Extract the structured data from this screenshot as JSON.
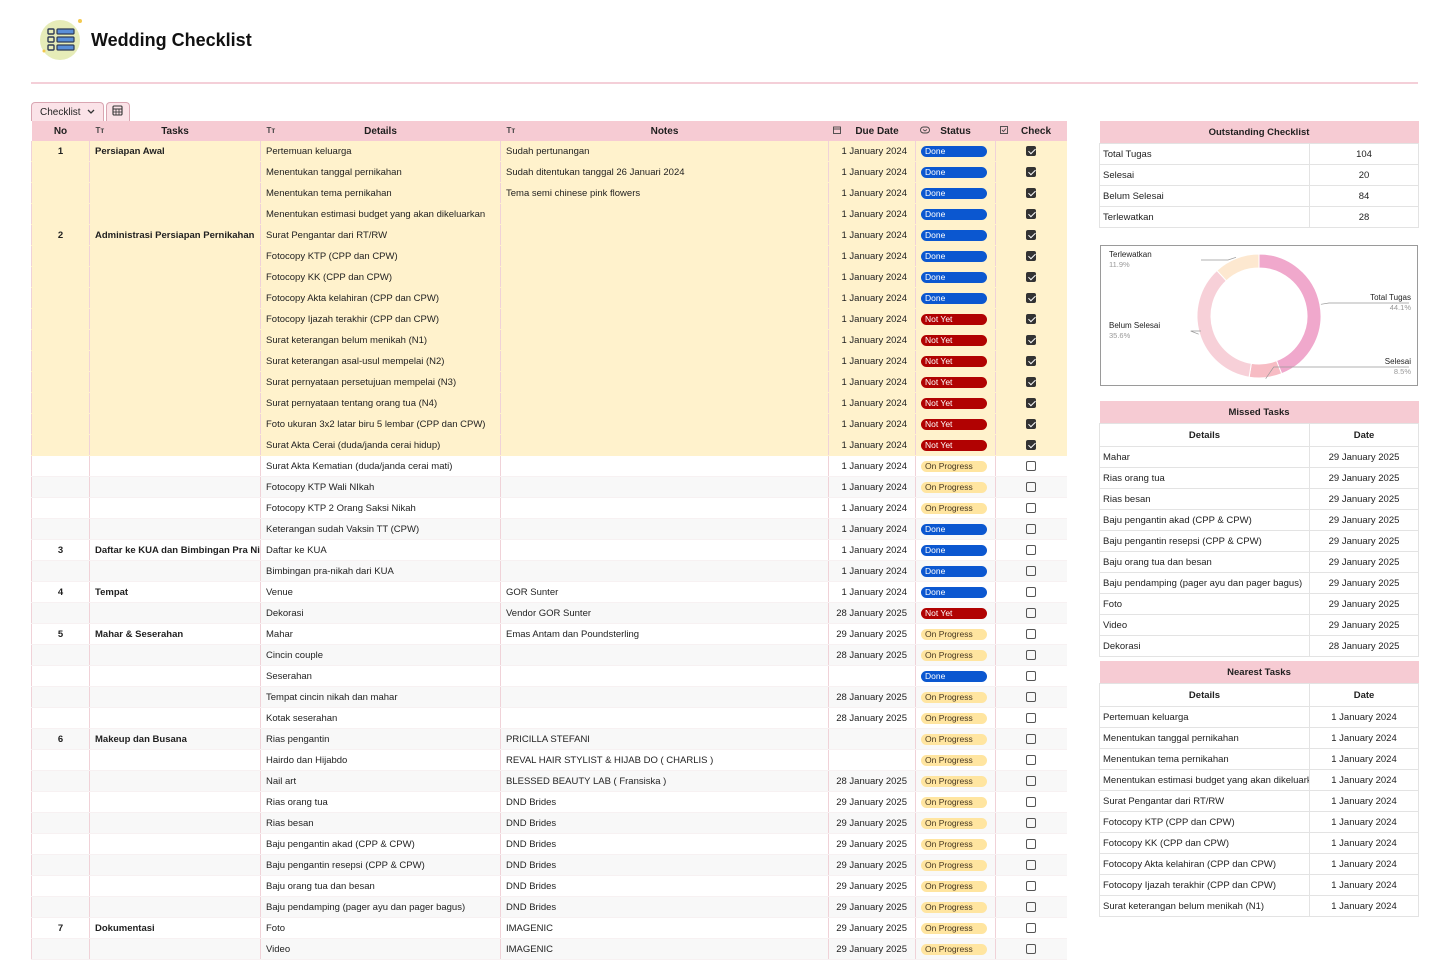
{
  "page": {
    "title": "Wedding Checklist",
    "tab_label": "Checklist"
  },
  "colors": {
    "header_pink": "#f6cbd3",
    "done": "#0b57d0",
    "not_yet": "#b10202",
    "on_progress": "#ffe5a0",
    "row_highlight": "#fff2cc"
  },
  "main_table": {
    "headers": [
      "No",
      "Tasks",
      "Details",
      "Notes",
      "Due Date",
      "Status",
      "Check"
    ],
    "rows": [
      {
        "no": "1",
        "task": "Persiapan Awal",
        "detail": "Pertemuan keluarga",
        "notes": "Sudah pertunangan",
        "due": "1 January 2024",
        "status": "Done",
        "check": true
      },
      {
        "no": "",
        "task": "",
        "detail": "Menentukan tanggal pernikahan",
        "notes": "Sudah ditentukan tanggal 26 Januari 2024",
        "due": "1 January 2024",
        "status": "Done",
        "check": true
      },
      {
        "no": "",
        "task": "",
        "detail": "Menentukan tema pernikahan",
        "notes": "Tema semi chinese pink flowers",
        "due": "1 January 2024",
        "status": "Done",
        "check": true
      },
      {
        "no": "",
        "task": "",
        "detail": "Menentukan estimasi budget yang akan dikeluarkan",
        "notes": "",
        "due": "1 January 2024",
        "status": "Done",
        "check": true
      },
      {
        "no": "2",
        "task": "Administrasi Persiapan Pernikahan",
        "detail": "Surat Pengantar dari RT/RW",
        "notes": "",
        "due": "1 January 2024",
        "status": "Done",
        "check": true
      },
      {
        "no": "",
        "task": "",
        "detail": "Fotocopy KTP (CPP dan CPW)",
        "notes": "",
        "due": "1 January 2024",
        "status": "Done",
        "check": true
      },
      {
        "no": "",
        "task": "",
        "detail": "Fotocopy KK (CPP dan CPW)",
        "notes": "",
        "due": "1 January 2024",
        "status": "Done",
        "check": true
      },
      {
        "no": "",
        "task": "",
        "detail": "Fotocopy Akta kelahiran (CPP dan CPW)",
        "notes": "",
        "due": "1 January 2024",
        "status": "Done",
        "check": true
      },
      {
        "no": "",
        "task": "",
        "detail": "Fotocopy Ijazah terakhir (CPP dan CPW)",
        "notes": "",
        "due": "1 January 2024",
        "status": "Not Yet",
        "check": true
      },
      {
        "no": "",
        "task": "",
        "detail": "Surat keterangan belum menikah (N1)",
        "notes": "",
        "due": "1 January 2024",
        "status": "Not Yet",
        "check": true
      },
      {
        "no": "",
        "task": "",
        "detail": "Surat keterangan asal-usul mempelai (N2)",
        "notes": "",
        "due": "1 January 2024",
        "status": "Not Yet",
        "check": true
      },
      {
        "no": "",
        "task": "",
        "detail": "Surat pernyataan persetujuan mempelai (N3)",
        "notes": "",
        "due": "1 January 2024",
        "status": "Not Yet",
        "check": true
      },
      {
        "no": "",
        "task": "",
        "detail": "Surat pernyataan tentang orang tua (N4)",
        "notes": "",
        "due": "1 January 2024",
        "status": "Not Yet",
        "check": true
      },
      {
        "no": "",
        "task": "",
        "detail": "Foto ukuran 3x2 latar biru 5 lembar (CPP dan CPW)",
        "notes": "",
        "due": "1 January 2024",
        "status": "Not Yet",
        "check": true
      },
      {
        "no": "",
        "task": "",
        "detail": "Surat Akta Cerai  (duda/janda cerai hidup)",
        "notes": "",
        "due": "1 January 2024",
        "status": "Not Yet",
        "check": true
      },
      {
        "no": "",
        "task": "",
        "detail": "Surat Akta Kematian (duda/janda cerai mati)",
        "notes": "",
        "due": "1 January 2024",
        "status": "On Progress",
        "check": false
      },
      {
        "no": "",
        "task": "",
        "detail": "Fotocopy KTP Wali NIkah",
        "notes": "",
        "due": "1 January 2024",
        "status": "On Progress",
        "check": false
      },
      {
        "no": "",
        "task": "",
        "detail": "Fotocopy KTP 2 Orang Saksi Nikah",
        "notes": "",
        "due": "1 January 2024",
        "status": "On Progress",
        "check": false
      },
      {
        "no": "",
        "task": "",
        "detail": "Keterangan sudah Vaksin TT (CPW)",
        "notes": "",
        "due": "1 January 2024",
        "status": "Done",
        "check": false
      },
      {
        "no": "3",
        "task": "Daftar ke KUA dan Bimbingan Pra Nikah",
        "detail": "Daftar ke KUA",
        "notes": "",
        "due": "1 January 2024",
        "status": "Done",
        "check": false
      },
      {
        "no": "",
        "task": "",
        "detail": "Bimbingan pra-nikah dari KUA",
        "notes": "",
        "due": "1 January 2024",
        "status": "Done",
        "check": false
      },
      {
        "no": "4",
        "task": "Tempat",
        "detail": "Venue",
        "notes": "GOR Sunter",
        "due": "1 January 2024",
        "status": "Done",
        "check": false
      },
      {
        "no": "",
        "task": "",
        "detail": "Dekorasi",
        "notes": "Vendor GOR Sunter",
        "due": "28 January 2025",
        "status": "Not Yet",
        "check": false
      },
      {
        "no": "5",
        "task": "Mahar & Seserahan",
        "detail": "Mahar",
        "notes": "Emas Antam dan Poundsterling",
        "due": "29 January 2025",
        "status": "On Progress",
        "check": false
      },
      {
        "no": "",
        "task": "",
        "detail": "Cincin couple",
        "notes": "",
        "due": "28 January 2025",
        "status": "On Progress",
        "check": false
      },
      {
        "no": "",
        "task": "",
        "detail": "Seserahan",
        "notes": "",
        "due": "",
        "status": "Done",
        "check": false
      },
      {
        "no": "",
        "task": "",
        "detail": "Tempat cincin nikah dan mahar",
        "notes": "",
        "due": "28 January 2025",
        "status": "On Progress",
        "check": false
      },
      {
        "no": "",
        "task": "",
        "detail": "Kotak seserahan",
        "notes": "",
        "due": "28 January 2025",
        "status": "On Progress",
        "check": false
      },
      {
        "no": "6",
        "task": "Makeup dan Busana",
        "detail": "Rias pengantin",
        "notes": "PRICILLA STEFANI",
        "due": "",
        "status": "On Progress",
        "check": false
      },
      {
        "no": "",
        "task": "",
        "detail": "Hairdo dan Hijabdo",
        "notes": "REVAL HAIR STYLIST & HIJAB DO ( CHARLIS )",
        "due": "",
        "status": "On Progress",
        "check": false
      },
      {
        "no": "",
        "task": "",
        "detail": "Nail art",
        "notes": "BLESSED BEAUTY LAB ( Fransiska )",
        "due": "28 January 2025",
        "status": "On Progress",
        "check": false
      },
      {
        "no": "",
        "task": "",
        "detail": "Rias orang tua",
        "notes": "DND Brides",
        "due": "29 January 2025",
        "status": "On Progress",
        "check": false
      },
      {
        "no": "",
        "task": "",
        "detail": "Rias besan",
        "notes": "DND Brides",
        "due": "29 January 2025",
        "status": "On Progress",
        "check": false
      },
      {
        "no": "",
        "task": "",
        "detail": "Baju pengantin akad (CPP & CPW)",
        "notes": "DND Brides",
        "due": "29 January 2025",
        "status": "On Progress",
        "check": false
      },
      {
        "no": "",
        "task": "",
        "detail": "Baju pengantin resepsi (CPP & CPW)",
        "notes": "DND Brides",
        "due": "29 January 2025",
        "status": "On Progress",
        "check": false
      },
      {
        "no": "",
        "task": "",
        "detail": "Baju orang tua dan besan",
        "notes": "DND Brides",
        "due": "29 January 2025",
        "status": "On Progress",
        "check": false
      },
      {
        "no": "",
        "task": "",
        "detail": "Baju pendamping (pager ayu dan pager bagus)",
        "notes": "DND Brides",
        "due": "29 January 2025",
        "status": "On Progress",
        "check": false
      },
      {
        "no": "7",
        "task": "Dokumentasi",
        "detail": "Foto",
        "notes": "IMAGENIC",
        "due": "29 January 2025",
        "status": "On Progress",
        "check": false
      },
      {
        "no": "",
        "task": "",
        "detail": "Video",
        "notes": "IMAGENIC",
        "due": "29 January 2025",
        "status": "On Progress",
        "check": false
      }
    ]
  },
  "outstanding": {
    "title": "Outstanding Checklist",
    "rows": [
      {
        "label": "Total Tugas",
        "value": "104"
      },
      {
        "label": "Selesai",
        "value": "20"
      },
      {
        "label": "Belum Selesai",
        "value": "84"
      },
      {
        "label": "Terlewatkan",
        "value": "28"
      }
    ]
  },
  "chart_data": {
    "type": "pie",
    "donut": true,
    "slices": [
      {
        "label": "Total Tugas",
        "value": 44.1,
        "pct": "44.1%",
        "color": "#f0a8cc"
      },
      {
        "label": "Selesai",
        "value": 8.5,
        "pct": "8.5%",
        "color": "#f7bcc4"
      },
      {
        "label": "Belum Selesai",
        "value": 35.6,
        "pct": "35.6%",
        "color": "#f7d0d8"
      },
      {
        "label": "Terlewatkan",
        "value": 11.9,
        "pct": "11.9%",
        "color": "#fde8d0"
      }
    ]
  },
  "missed": {
    "title": "Missed Tasks",
    "headers": [
      "Details",
      "Date"
    ],
    "rows": [
      {
        "detail": "Mahar",
        "date": "29 January 2025"
      },
      {
        "detail": "Rias orang tua",
        "date": "29 January 2025"
      },
      {
        "detail": "Rias besan",
        "date": "29 January 2025"
      },
      {
        "detail": "Baju pengantin akad (CPP & CPW)",
        "date": "29 January 2025"
      },
      {
        "detail": "Baju pengantin resepsi (CPP & CPW)",
        "date": "29 January 2025"
      },
      {
        "detail": "Baju orang tua dan besan",
        "date": "29 January 2025"
      },
      {
        "detail": "Baju pendamping (pager ayu dan pager bagus)",
        "date": "29 January 2025"
      },
      {
        "detail": "Foto",
        "date": "29 January 2025"
      },
      {
        "detail": "Video",
        "date": "29 January 2025"
      },
      {
        "detail": "Dekorasi",
        "date": "28 January 2025"
      }
    ]
  },
  "nearest": {
    "title": "Nearest Tasks",
    "headers": [
      "Details",
      "Date"
    ],
    "rows": [
      {
        "detail": "Pertemuan keluarga",
        "date": "1 January 2024"
      },
      {
        "detail": "Menentukan tanggal pernikahan",
        "date": "1 January 2024"
      },
      {
        "detail": "Menentukan tema pernikahan",
        "date": "1 January 2024"
      },
      {
        "detail": "Menentukan estimasi budget yang akan dikeluarkan",
        "date": "1 January 2024"
      },
      {
        "detail": "Surat Pengantar dari RT/RW",
        "date": "1 January 2024"
      },
      {
        "detail": "Fotocopy KTP (CPP dan CPW)",
        "date": "1 January 2024"
      },
      {
        "detail": "Fotocopy KK (CPP dan CPW)",
        "date": "1 January 2024"
      },
      {
        "detail": "Fotocopy Akta kelahiran (CPP dan CPW)",
        "date": "1 January 2024"
      },
      {
        "detail": "Fotocopy Ijazah terakhir (CPP dan CPW)",
        "date": "1 January 2024"
      },
      {
        "detail": "Surat keterangan belum menikah (N1)",
        "date": "1 January 2024"
      }
    ]
  }
}
